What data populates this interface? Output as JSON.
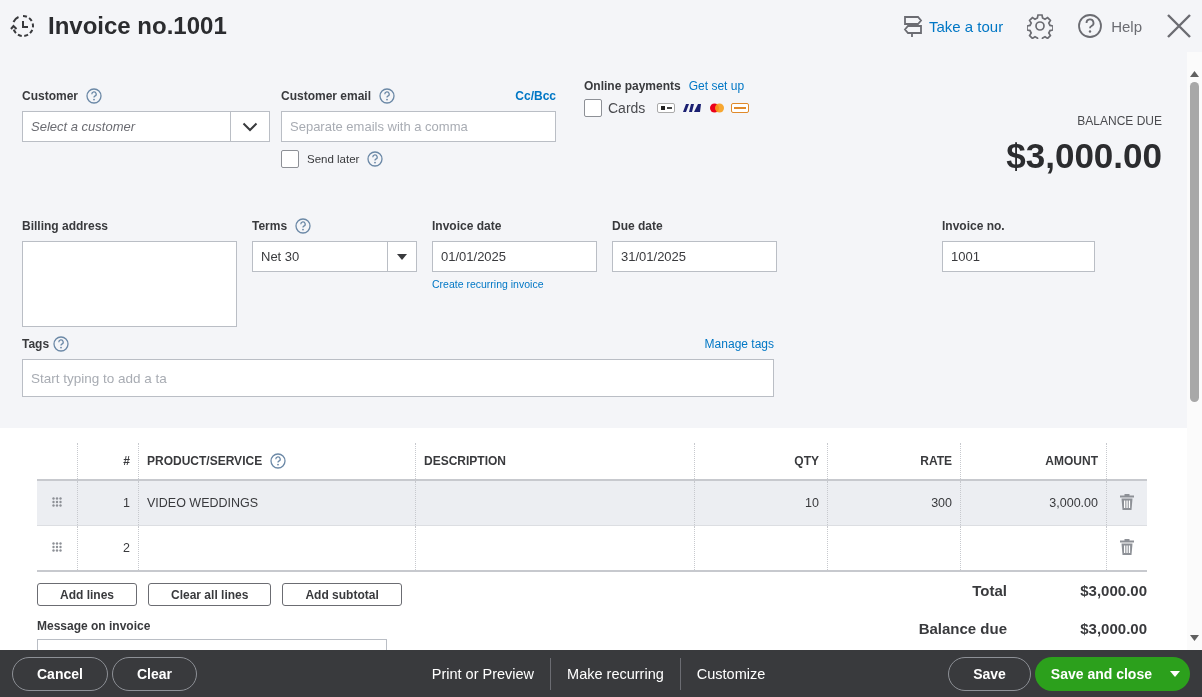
{
  "header": {
    "title": "Invoice no.1001",
    "tour_link": "Take a tour",
    "help_link": "Help"
  },
  "customer": {
    "label": "Customer",
    "placeholder": "Select a customer"
  },
  "customer_email": {
    "label": "Customer email",
    "placeholder": "Separate emails with a comma",
    "cc_bcc": "Cc/Bcc",
    "send_later": {
      "label": "Send later",
      "checked": false
    }
  },
  "online_payments": {
    "label": "Online payments",
    "setup_link": "Get set up",
    "cards": {
      "label": "Cards",
      "checked": false
    }
  },
  "balance": {
    "label": "BALANCE DUE",
    "amount": "$3,000.00"
  },
  "billing_address": {
    "label": "Billing address"
  },
  "terms": {
    "label": "Terms",
    "value": "Net 30"
  },
  "invoice_date": {
    "label": "Invoice date",
    "value": "01/01/2025",
    "recurring_link": "Create recurring invoice"
  },
  "due_date": {
    "label": "Due date",
    "value": "31/01/2025"
  },
  "invoice_no": {
    "label": "Invoice no.",
    "value": "1001"
  },
  "tags": {
    "label": "Tags",
    "placeholder": "Start typing to add a ta",
    "manage_link": "Manage tags"
  },
  "table": {
    "columns": [
      {
        "label": "#",
        "kind": "num"
      },
      {
        "label": "PRODUCT/SERVICE",
        "kind": "product"
      },
      {
        "label": "DESCRIPTION",
        "kind": "text"
      },
      {
        "label": "QTY",
        "kind": "numeric"
      },
      {
        "label": "RATE",
        "kind": "numeric"
      },
      {
        "label": "AMOUNT",
        "kind": "numeric"
      }
    ],
    "rows": [
      {
        "number": "1",
        "product": "VIDEO WEDDINGS",
        "qty": "10",
        "rate": "300",
        "amount": "3,000.00",
        "selected": true
      },
      {
        "number": "2",
        "selected": false
      }
    ]
  },
  "line_buttons": [
    "Add lines",
    "Clear all lines",
    "Add subtotal"
  ],
  "message": {
    "label": "Message on invoice"
  },
  "totals": [
    {
      "label": "Total",
      "value": "$3,000.00"
    },
    {
      "label": "Balance due",
      "value": "$3,000.00"
    }
  ],
  "footer": {
    "left_buttons": [
      "Cancel",
      "Clear"
    ],
    "center_links": [
      "Print or Preview",
      "Make recurring",
      "Customize"
    ],
    "save": "Save",
    "save_close": "Save and close"
  }
}
